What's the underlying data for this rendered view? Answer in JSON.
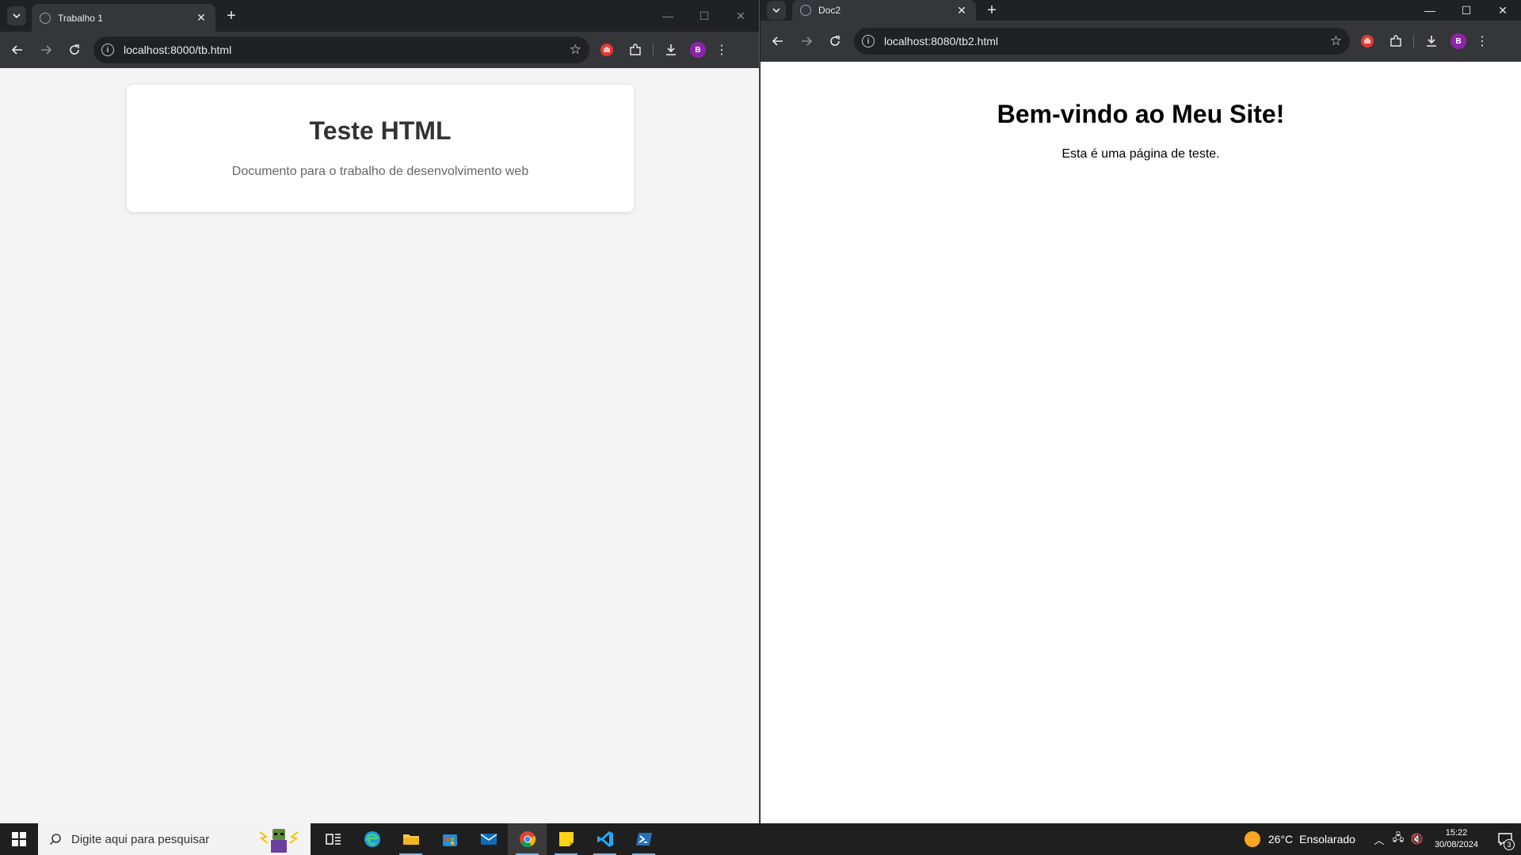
{
  "left_window": {
    "tab_title": "Trabalho 1",
    "url": "localhost:8000/tb.html",
    "avatar_letter": "B",
    "page": {
      "heading": "Teste HTML",
      "subtitle": "Documento para o trabalho de desenvolvimento web"
    }
  },
  "right_window": {
    "tab_title": "Doc2",
    "url": "localhost:8080/tb2.html",
    "avatar_letter": "B",
    "page": {
      "heading": "Bem-vindo ao Meu Site!",
      "subtitle": "Esta é uma página de teste."
    }
  },
  "taskbar": {
    "search_placeholder": "Digite aqui para pesquisar",
    "apps": [
      "task-view",
      "edge",
      "file-explorer",
      "microsoft-store",
      "mail",
      "chrome",
      "sticky-notes",
      "vscode",
      "powershell"
    ],
    "weather_temp": "26°C",
    "weather_desc": "Ensolarado",
    "time": "15:22",
    "date": "30/08/2024",
    "notification_count": "3"
  },
  "colors": {
    "chrome_frame": "#202124",
    "chrome_toolbar": "#35363a",
    "avatar": "#8e24aa",
    "ext_red": "#e53935",
    "taskbar": "#1f1f1f"
  }
}
